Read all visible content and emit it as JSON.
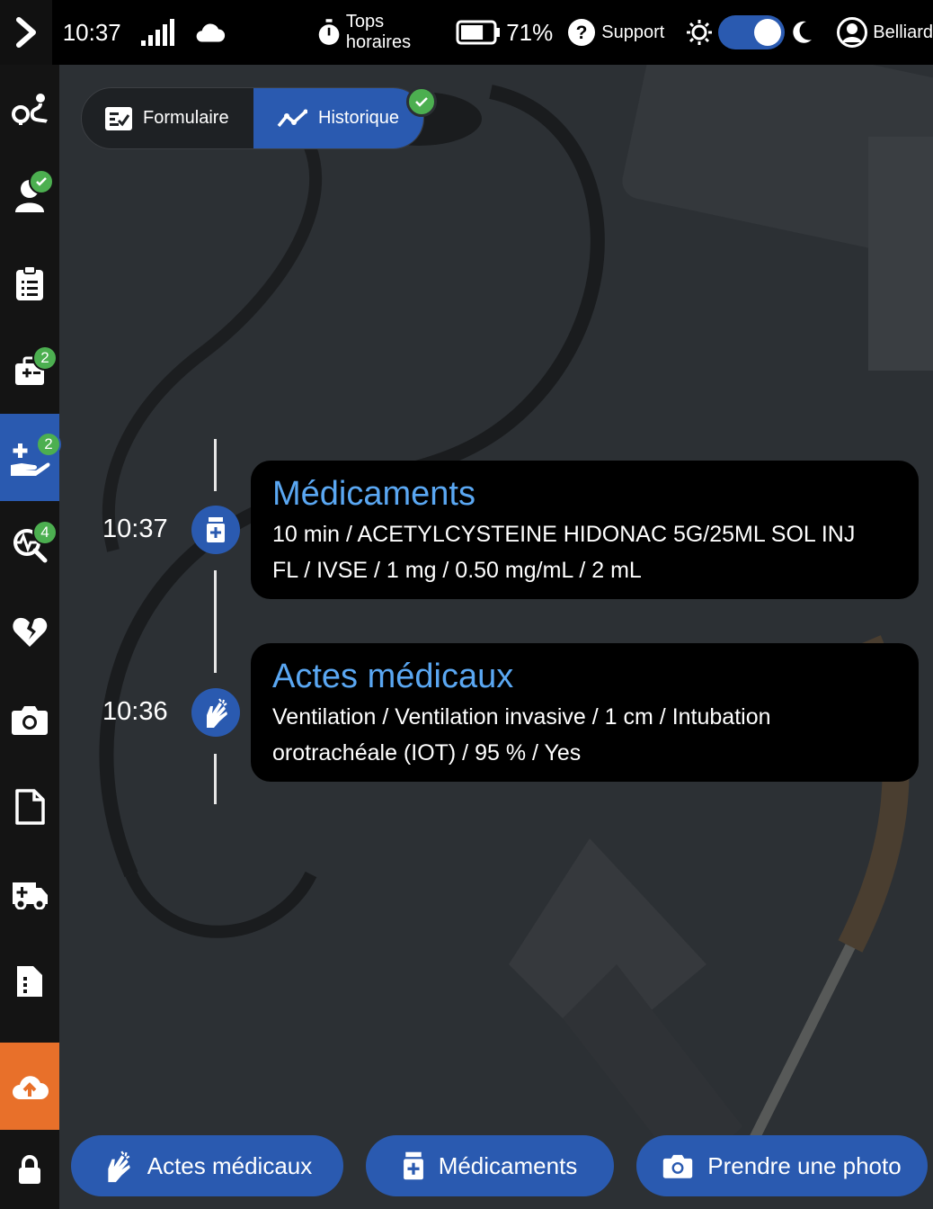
{
  "topbar": {
    "time": "10:37",
    "tops_label": "Tops horaires",
    "battery": "71%",
    "battery_level": 71,
    "support_label": "Support",
    "theme_dark": true,
    "user_name": "Belliard"
  },
  "sidebar": {
    "items": [
      {
        "icon": "route-icon"
      },
      {
        "icon": "patient-icon",
        "check": true
      },
      {
        "icon": "clipboard-list-icon"
      },
      {
        "icon": "medical-kit-icon",
        "badge": "2"
      },
      {
        "icon": "hand-care-icon",
        "badge": "2",
        "active": true
      },
      {
        "icon": "vitals-search-icon",
        "badge": "4"
      },
      {
        "icon": "broken-heart-icon"
      },
      {
        "icon": "camera-icon"
      },
      {
        "icon": "document-icon"
      },
      {
        "icon": "ambulance-icon"
      },
      {
        "icon": "file-dots-icon"
      },
      {
        "icon": "cloud-upload-icon"
      },
      {
        "icon": "lock-icon"
      }
    ]
  },
  "tabs": {
    "form_label": "Formulaire",
    "history_label": "Historique"
  },
  "timeline": [
    {
      "time": "10:37",
      "icon": "medication-icon",
      "title": "Médicaments",
      "line1": "10 min / ACETYLCYSTEINE HIDONAC 5G/25ML SOL INJ",
      "line2": "FL / IVSE / 1 mg / 0.50 mg/mL / 2 mL"
    },
    {
      "time": "10:36",
      "icon": "hands-icon",
      "title": "Actes médicaux",
      "line1": "Ventilation / Ventilation invasive / 1 cm / Intubation",
      "line2": "orotrachéale (IOT) / 95 % / Yes"
    }
  ],
  "bottom": {
    "acts_label": "Actes médicaux",
    "meds_label": "Médicaments",
    "photo_label": "Prendre une photo"
  },
  "colors": {
    "accent": "#2a5ab0",
    "title_blue": "#5aa7f2",
    "success": "#4caf50",
    "upload": "#e8702a"
  }
}
